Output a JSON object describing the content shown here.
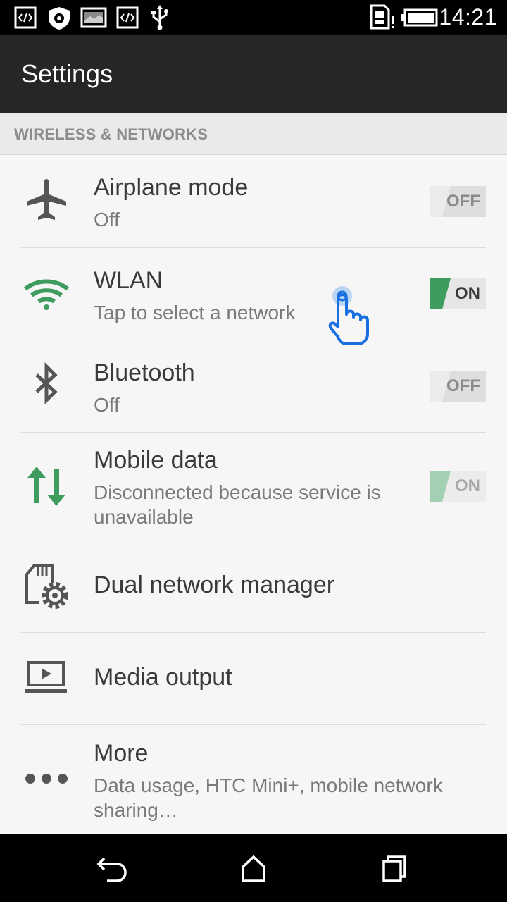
{
  "status_bar": {
    "time": "14:21",
    "icons": [
      "code-icon",
      "shield-gear-icon",
      "image-icon",
      "code-icon",
      "usb-icon",
      "sim-alert-icon",
      "battery-icon"
    ]
  },
  "app_bar": {
    "title": "Settings"
  },
  "section": {
    "title": "WIRELESS & NETWORKS"
  },
  "items": [
    {
      "title": "Airplane mode",
      "subtitle": "Off",
      "icon": "airplane-icon",
      "toggle": "OFF",
      "toggle_state": "off"
    },
    {
      "title": "WLAN",
      "subtitle": "Tap to select a network",
      "icon": "wifi-icon",
      "toggle": "ON",
      "toggle_state": "on"
    },
    {
      "title": "Bluetooth",
      "subtitle": "Off",
      "icon": "bluetooth-icon",
      "toggle": "OFF",
      "toggle_state": "off"
    },
    {
      "title": "Mobile data",
      "subtitle": "Disconnected because service is unavailable",
      "icon": "data-arrows-icon",
      "toggle": "ON",
      "toggle_state": "on-disabled"
    },
    {
      "title": "Dual network manager",
      "icon": "sim-gear-icon"
    },
    {
      "title": "Media output",
      "icon": "media-play-icon"
    },
    {
      "title": "More",
      "subtitle": "Data usage, HTC Mini+, mobile network sharing…",
      "icon": "more-dots-icon"
    }
  ],
  "nav_bar": {
    "buttons": [
      "back-icon",
      "home-icon",
      "recents-icon"
    ]
  },
  "colors": {
    "toggle_on": "#3f9c5f",
    "toggle_on_disabled": "#a3d0b3",
    "wifi": "#3f9c5f",
    "touch_indicator": "#1a6fe0"
  }
}
